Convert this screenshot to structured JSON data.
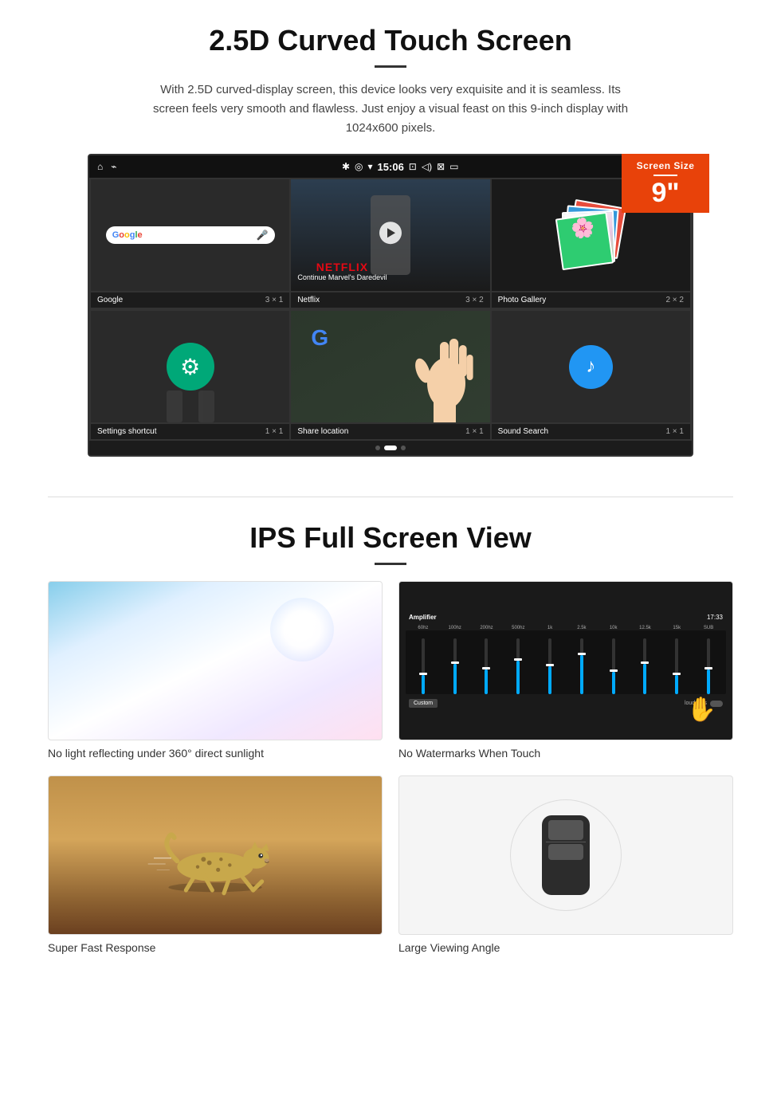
{
  "section1": {
    "title": "2.5D Curved Touch Screen",
    "description": "With 2.5D curved-display screen, this device looks very exquisite and it is seamless. Its screen feels very smooth and flawless. Just enjoy a visual feast on this 9-inch display with 1024x600 pixels.",
    "badge": {
      "label": "Screen Size",
      "size": "9\""
    },
    "statusBar": {
      "time": "15:06"
    },
    "apps": {
      "row1": [
        {
          "name": "Google",
          "size": "3 × 1"
        },
        {
          "name": "Netflix",
          "size": "3 × 2"
        },
        {
          "name": "Photo Gallery",
          "size": "2 × 2"
        }
      ],
      "row2": [
        {
          "name": "Settings shortcut",
          "size": "1 × 1"
        },
        {
          "name": "Share location",
          "size": "1 × 1"
        },
        {
          "name": "Sound Search",
          "size": "1 × 1"
        }
      ]
    },
    "netflix": {
      "logo": "NETFLIX",
      "subtitle": "Continue Marvel's Daredevil"
    }
  },
  "section2": {
    "title": "IPS Full Screen View",
    "features": [
      {
        "id": "sunlight",
        "caption": "No light reflecting under 360° direct sunlight"
      },
      {
        "id": "amplifier",
        "caption": "No Watermarks When Touch",
        "ui_title": "Amplifier",
        "ui_time": "17:33",
        "eq_labels": [
          "60hz",
          "100hz",
          "200hz",
          "500hz",
          "1k",
          "2.5k",
          "10k",
          "12.5k",
          "15k",
          "SUB"
        ],
        "custom_btn": "Custom",
        "loudness_label": "loudness"
      },
      {
        "id": "cheetah",
        "caption": "Super Fast Response"
      },
      {
        "id": "car",
        "caption": "Large Viewing Angle"
      }
    ]
  }
}
